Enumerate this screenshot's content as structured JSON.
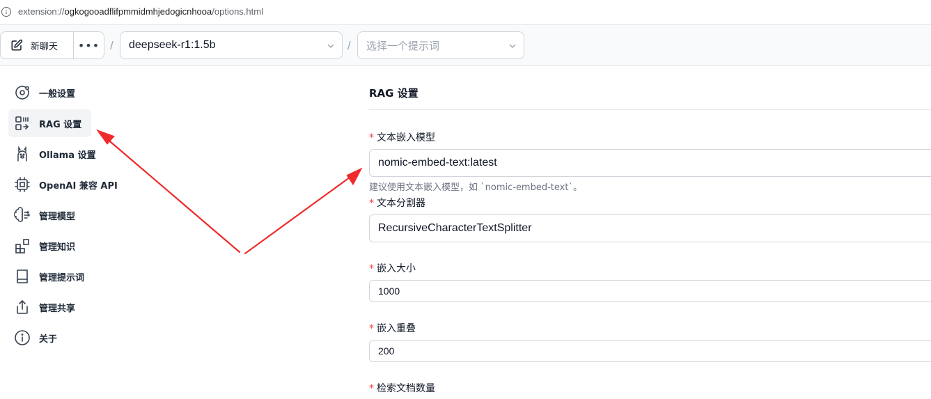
{
  "browser": {
    "url_scheme": "extension://",
    "url_host": "ogkogooadflifpmmidmhjedogicnhooa",
    "url_path": "/options.html"
  },
  "toolbar": {
    "new_chat_label": "新聊天",
    "more_label": "•••",
    "separator": "/",
    "model_select_value": "deepseek-r1:1.5b",
    "prompt_select_placeholder": "选择一个提示词"
  },
  "sidebar": {
    "items": [
      {
        "label": "一般设置",
        "icon": "settings-orbit-icon",
        "active": false
      },
      {
        "label": "RAG 设置",
        "icon": "rag-scan-icon",
        "active": true
      },
      {
        "label": "Ollama 设置",
        "icon": "llama-icon",
        "active": false
      },
      {
        "label": "OpenAI 兼容 API",
        "icon": "cpu-chip-icon",
        "active": false
      },
      {
        "label": "管理模型",
        "icon": "brain-icon",
        "active": false
      },
      {
        "label": "管理知识",
        "icon": "blocks-icon",
        "active": false
      },
      {
        "label": "管理提示词",
        "icon": "book-icon",
        "active": false
      },
      {
        "label": "管理共享",
        "icon": "share-icon",
        "active": false
      },
      {
        "label": "关于",
        "icon": "info-icon",
        "active": false
      }
    ]
  },
  "main": {
    "title": "RAG 设置",
    "required_mark": "*",
    "fields": {
      "embedding_model": {
        "label": "文本嵌入模型",
        "value": "nomic-embed-text:latest",
        "hint": "建议使用文本嵌入模型，如 `nomic-embed-text`。"
      },
      "text_splitter": {
        "label": "文本分割器",
        "value": "RecursiveCharacterTextSplitter"
      },
      "chunk_size": {
        "label": "嵌入大小",
        "value": "1000"
      },
      "chunk_overlap": {
        "label": "嵌入重叠",
        "value": "200"
      },
      "num_docs": {
        "label": "检索文档数量"
      }
    }
  },
  "colors": {
    "annotation_arrow": "#ef2b2b",
    "required": "#ef4444",
    "active_nav_bg": "#f3f4f6"
  }
}
